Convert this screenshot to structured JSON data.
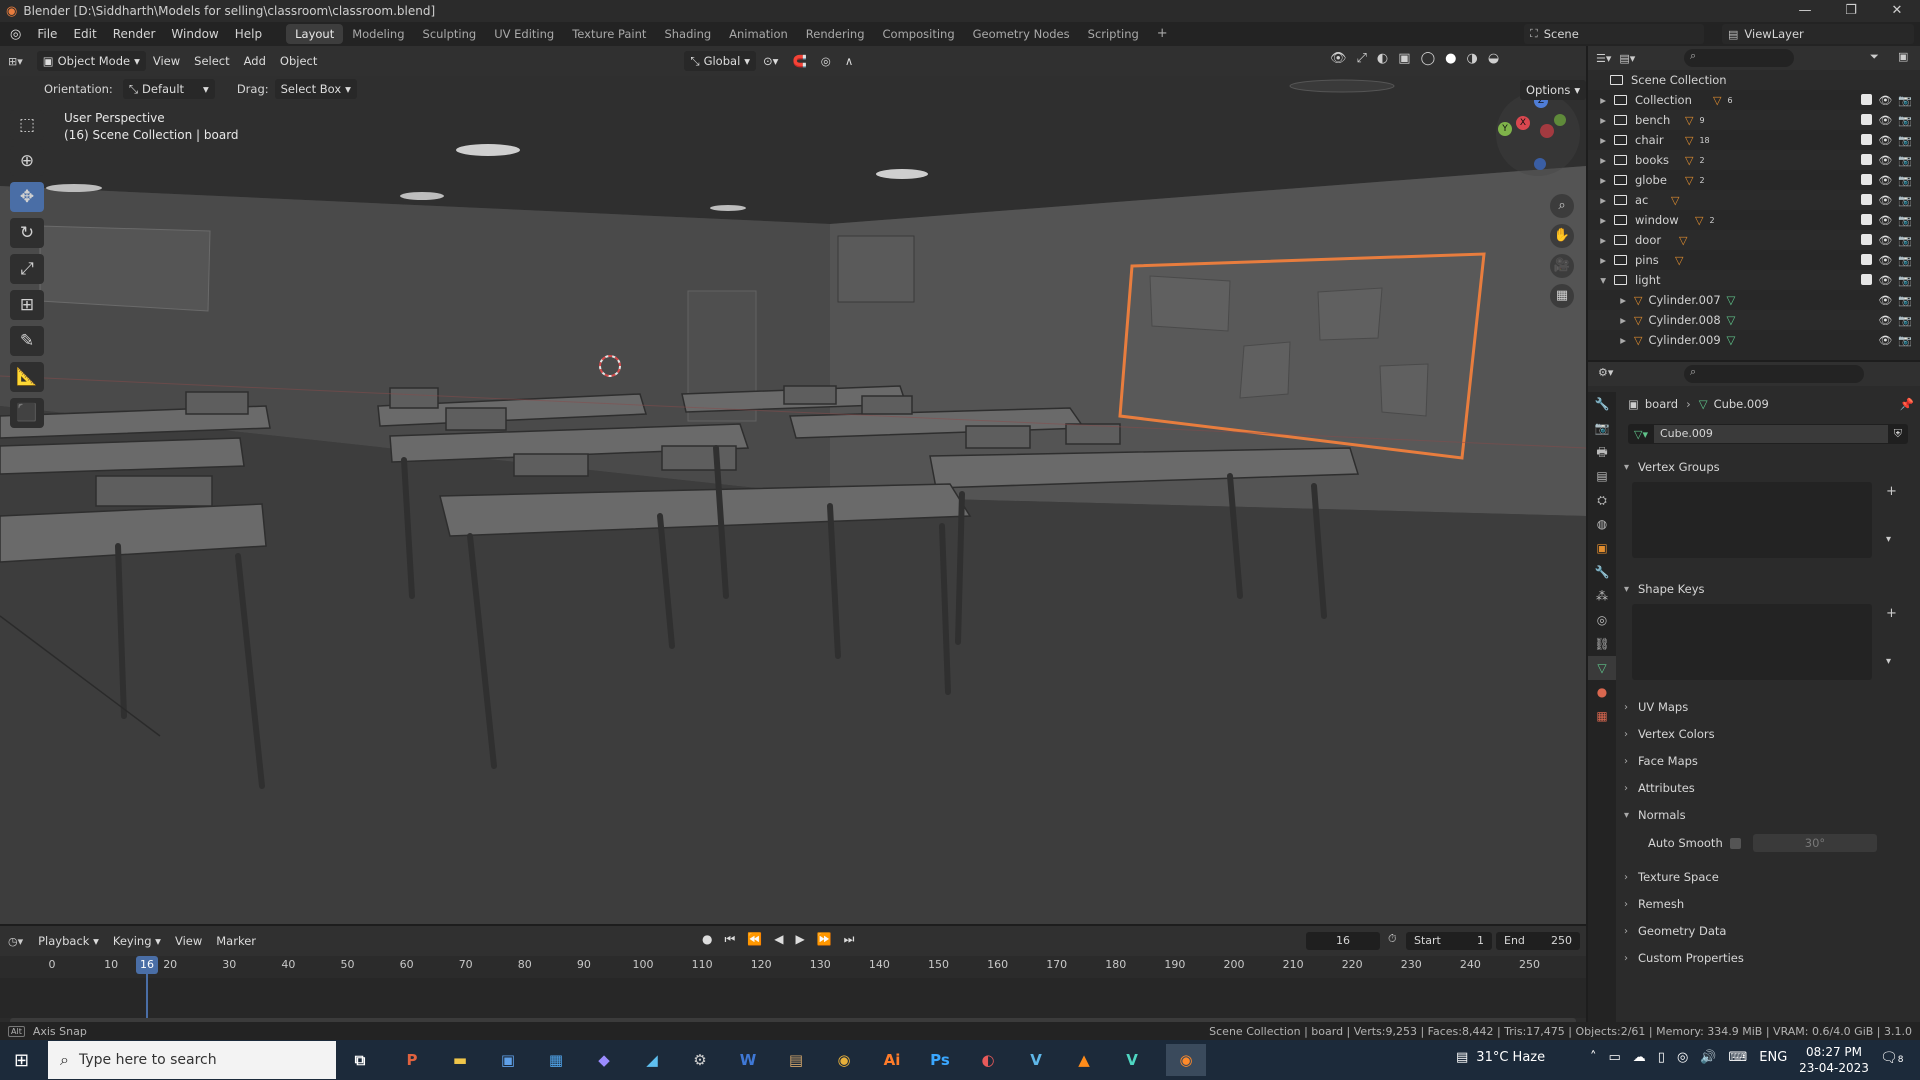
{
  "window": {
    "title": "Blender [D:\\Siddharth\\Models for selling\\classroom\\classroom.blend]",
    "minimize": "—",
    "maximize": "❐",
    "close": "✕"
  },
  "menu": [
    "File",
    "Edit",
    "Render",
    "Window",
    "Help"
  ],
  "workspaces": [
    "Layout",
    "Modeling",
    "Sculpting",
    "UV Editing",
    "Texture Paint",
    "Shading",
    "Animation",
    "Rendering",
    "Compositing",
    "Geometry Nodes",
    "Scripting"
  ],
  "active_workspace": "Layout",
  "scene": {
    "name": "Scene",
    "viewlayer": "ViewLayer"
  },
  "viewport_header": {
    "mode": "Object Mode",
    "menus": [
      "View",
      "Select",
      "Add",
      "Object"
    ],
    "transform_orientation": "Global",
    "options": "Options"
  },
  "tool_settings": {
    "orientation_label": "Orientation:",
    "orientation_value": "Default",
    "drag_label": "Drag:",
    "drag_value": "Select Box"
  },
  "viewport_overlay": {
    "perspective": "User Perspective",
    "collection_info": "(16) Scene Collection | board"
  },
  "gizmo": {
    "x": "X",
    "y": "Y",
    "z": "Z"
  },
  "outliner": {
    "root": "Scene Collection",
    "items": [
      {
        "name": "Collection",
        "badge": "6"
      },
      {
        "name": "bench",
        "badge": "9"
      },
      {
        "name": "chair",
        "badge": "18"
      },
      {
        "name": "books",
        "badge": "2"
      },
      {
        "name": "globe",
        "badge": "2"
      },
      {
        "name": "ac",
        "badge": ""
      },
      {
        "name": "window",
        "badge": "2"
      },
      {
        "name": "door",
        "badge": ""
      },
      {
        "name": "pins",
        "badge": ""
      },
      {
        "name": "light",
        "badge": ""
      }
    ],
    "children": [
      "Cylinder.007",
      "Cylinder.008",
      "Cylinder.009"
    ]
  },
  "properties": {
    "breadcrumb_object": "board",
    "breadcrumb_data": "Cube.009",
    "data_name": "Cube.009",
    "sections": {
      "vertex_groups": "Vertex Groups",
      "shape_keys": "Shape Keys",
      "uv_maps": "UV Maps",
      "vertex_colors": "Vertex Colors",
      "face_maps": "Face Maps",
      "attributes": "Attributes",
      "normals": "Normals",
      "texture_space": "Texture Space",
      "remesh": "Remesh",
      "geometry_data": "Geometry Data",
      "custom_properties": "Custom Properties"
    },
    "auto_smooth_label": "Auto Smooth",
    "auto_smooth_angle": "30°"
  },
  "timeline": {
    "menus": [
      "Playback",
      "Keying",
      "View",
      "Marker"
    ],
    "current_frame": "16",
    "start_label": "Start",
    "start": "1",
    "end_label": "End",
    "end": "250",
    "ticks": [
      "0",
      "10",
      "20",
      "30",
      "40",
      "50",
      "60",
      "70",
      "80",
      "90",
      "100",
      "110",
      "120",
      "130",
      "140",
      "150",
      "160",
      "170",
      "180",
      "190",
      "200",
      "210",
      "220",
      "230",
      "240",
      "250"
    ],
    "playhead_label": "16"
  },
  "statusbar": {
    "left": "Axis Snap",
    "right": "Scene Collection | board | Verts:9,253 | Faces:8,442 | Tris:17,475 | Objects:2/61 | Memory: 334.9 MiB | VRAM: 0.6/4.0 GiB | 3.1.0"
  },
  "taskbar": {
    "search_placeholder": "Type here to search",
    "weather": "31°C  Haze",
    "lang": "ENG",
    "time": "08:27 PM",
    "date": "23-04-2023",
    "notification_count": "8"
  },
  "colors": {
    "accent": "#4a6ea6",
    "selection": "#e87d3e",
    "mesh_icon": "#e08d2f"
  }
}
